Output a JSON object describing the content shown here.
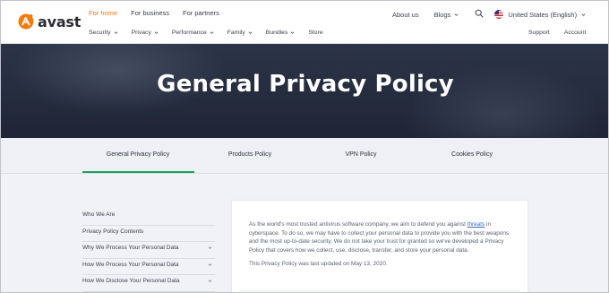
{
  "header": {
    "logo_text": "avast",
    "brand_color": "#f27b0d",
    "top_nav": [
      "For home",
      "For business",
      "For partners"
    ],
    "active_top": "For home",
    "right_nav": {
      "about": "About us",
      "blogs": "Blogs",
      "search_icon": "search-icon",
      "language": "United States (English)"
    },
    "sub_nav": [
      {
        "label": "Security",
        "dropdown": true
      },
      {
        "label": "Privacy",
        "dropdown": true
      },
      {
        "label": "Performance",
        "dropdown": true
      },
      {
        "label": "Family",
        "dropdown": true
      },
      {
        "label": "Bundles",
        "dropdown": true
      },
      {
        "label": "Store",
        "dropdown": false
      }
    ],
    "sub_right": [
      "Support",
      "Account"
    ]
  },
  "hero": {
    "title": "General Privacy Policy"
  },
  "tabs": {
    "items": [
      "General Privacy Policy",
      "Products Policy",
      "VPN Policy",
      "Cookies Policy"
    ],
    "active": "General Privacy Policy",
    "accent_color": "#1aa25c"
  },
  "sidebar": {
    "items": [
      {
        "label": "Who We Are",
        "expandable": false
      },
      {
        "label": "Privacy Policy Contents",
        "expandable": false
      },
      {
        "label": "Why We Process Your Personal Data",
        "expandable": true
      },
      {
        "label": "How We Process Your Personal Data",
        "expandable": true
      },
      {
        "label": "How We Disclose Your Personal Data",
        "expandable": true
      }
    ]
  },
  "content": {
    "p1_before_link": "As the world's most trusted antivirus software company, we aim to defend you against ",
    "p1_link": "threats",
    "p1_after_link": " in cyberspace. To do so, we may have to collect your personal data to provide you with the best weapons and the most up-to-date security. We do not take your trust for granted so we've developed a Privacy Policy that covers how we collect, use, disclose, transfer, and store your personal data.",
    "p2": "This Privacy Policy was last updated on May 13, 2020."
  }
}
